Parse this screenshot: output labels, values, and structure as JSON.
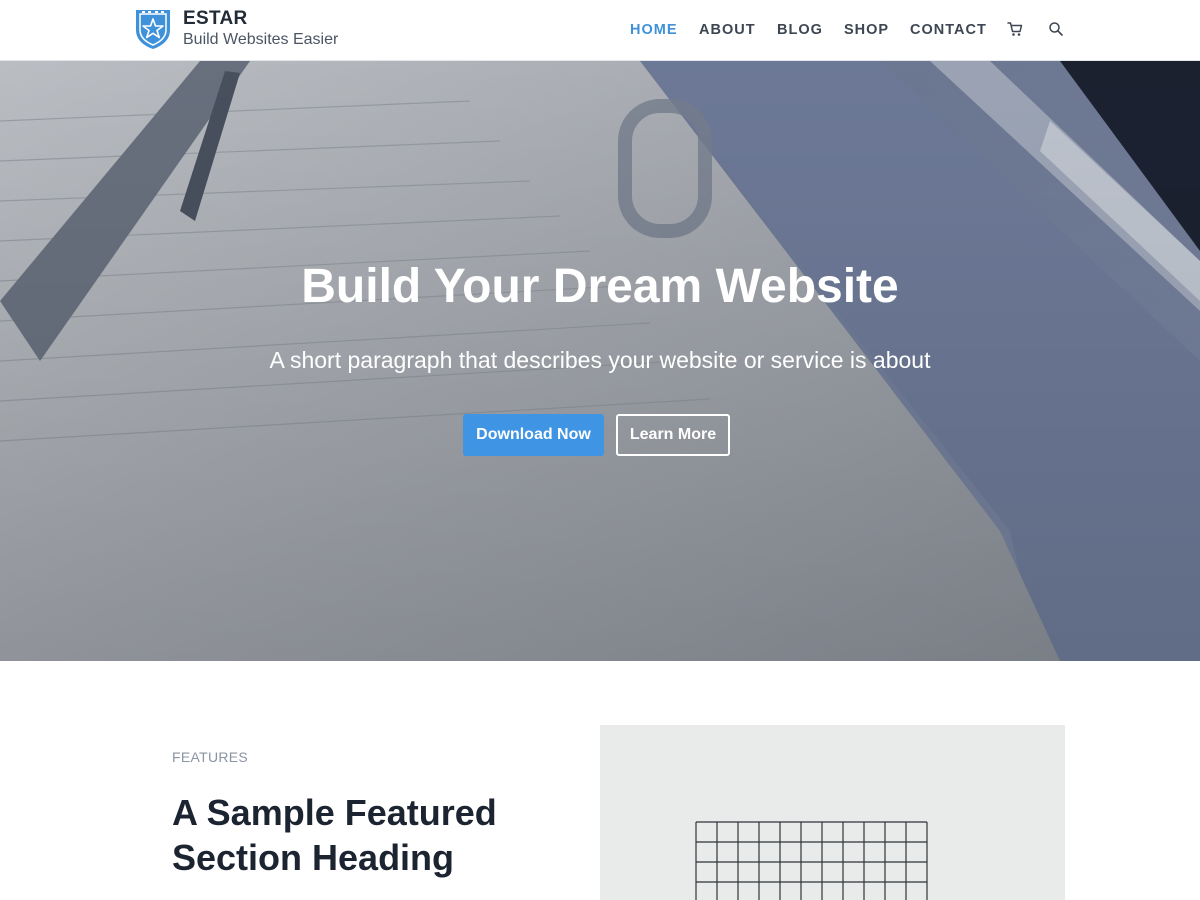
{
  "brand": {
    "title": "ESTAR",
    "tagline": "Build Websites Easier",
    "logo_icon": "shield-star-icon",
    "color": "#3f92d9"
  },
  "nav": {
    "items": [
      {
        "label": "HOME",
        "active": true
      },
      {
        "label": "ABOUT",
        "active": false
      },
      {
        "label": "BLOG",
        "active": false
      },
      {
        "label": "SHOP",
        "active": false
      },
      {
        "label": "CONTACT",
        "active": false
      }
    ],
    "cart_icon": "cart-icon",
    "search_icon": "search-icon"
  },
  "hero": {
    "title": "Build Your Dream Website",
    "subtitle": "A short paragraph that describes your website or service is about",
    "primary_button": "Download Now",
    "secondary_button": "Learn More",
    "accent": "#3f95e3"
  },
  "features": {
    "label": "FEATURES",
    "heading": "A Sample Featured Section Heading"
  }
}
